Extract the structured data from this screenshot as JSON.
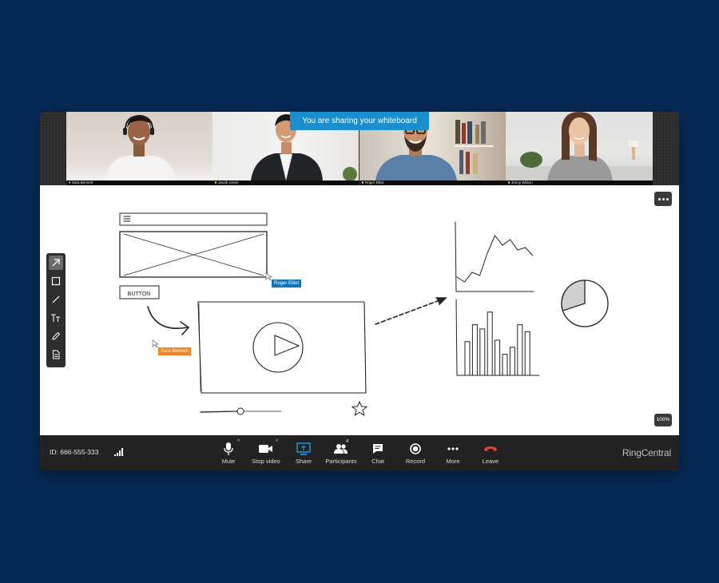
{
  "share_banner": "You are sharing your whiteboard",
  "participants": [
    {
      "name": "Sara Bennett",
      "active_speaker": true,
      "mic": "on"
    },
    {
      "name": "Jacob Jones",
      "active_speaker": false,
      "mic": "muted"
    },
    {
      "name": "Roger Elliot",
      "active_speaker": false,
      "mic": "muted"
    },
    {
      "name": "Jenny Wilson",
      "active_speaker": false,
      "mic": "muted"
    }
  ],
  "whiteboard": {
    "more_button_icon": "ellipsis-icon",
    "zoom_level": "100%",
    "tools": [
      {
        "name": "select",
        "icon": "arrow-icon",
        "selected": true
      },
      {
        "name": "rectangle",
        "icon": "square-icon",
        "selected": false
      },
      {
        "name": "line",
        "icon": "line-icon",
        "selected": false
      },
      {
        "name": "text",
        "icon": "text-icon",
        "selected": false
      },
      {
        "name": "pen",
        "icon": "pencil-icon",
        "selected": false
      },
      {
        "name": "document",
        "icon": "document-icon",
        "selected": false
      }
    ],
    "sketch_button_text": "BUTTON",
    "cursors": [
      {
        "name": "Roger Elliot",
        "color": "#1573b8"
      },
      {
        "name": "Sara Bennett",
        "color": "#f5821f"
      }
    ],
    "video_slider_progress": 0.5,
    "line_sketch_values": [
      18,
      12,
      24,
      20,
      48,
      70,
      58,
      65,
      52,
      55,
      45
    ],
    "bar_sketch_values": [
      48,
      72,
      66,
      90,
      50,
      30,
      40,
      72,
      62
    ],
    "pie_sketch_highlight_fraction": 0.3
  },
  "controlbar": {
    "meeting_id": "ID: 666-555-333",
    "buttons": [
      {
        "id": "mute",
        "label": "Mute",
        "icon": "microphone-icon",
        "has_caret": true
      },
      {
        "id": "stop-video",
        "label": "Stop video",
        "icon": "video-camera-icon",
        "has_caret": true
      },
      {
        "id": "share",
        "label": "Share",
        "icon": "share-screen-icon",
        "active": true
      },
      {
        "id": "participants",
        "label": "Participants",
        "icon": "participants-icon",
        "count": "4"
      },
      {
        "id": "chat",
        "label": "Chat",
        "icon": "chat-icon"
      },
      {
        "id": "record",
        "label": "Record",
        "icon": "record-icon"
      },
      {
        "id": "more",
        "label": "More",
        "icon": "more-icon"
      },
      {
        "id": "leave",
        "label": "Leave",
        "icon": "hang-up-icon"
      }
    ],
    "brand": "RingCentral"
  },
  "colors": {
    "background": "#062a57",
    "banner": "#1b8fcd",
    "active_speaker": "#6cc04a",
    "share_active": "#1b8fcd",
    "leave": "#e8422f"
  }
}
